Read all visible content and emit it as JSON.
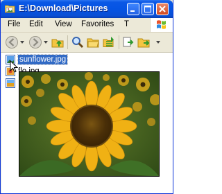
{
  "window": {
    "title": "E:\\Download\\Pictures"
  },
  "menu": {
    "items": [
      "File",
      "Edit",
      "View",
      "Favorites",
      "T"
    ]
  },
  "files": [
    {
      "name": "sunflower.jpg",
      "selected": true
    },
    {
      "name": "flo.jpg",
      "selected": false
    },
    {
      "name": "",
      "selected": false
    }
  ],
  "colors": {
    "titlebar": "#0554e3",
    "selection": "#316ac5",
    "chrome": "#ece9d8"
  },
  "icons": {
    "back": "back-arrow-icon",
    "forward": "forward-arrow-icon",
    "up": "folder-up-icon",
    "search": "search-icon",
    "folders": "folders-icon",
    "move": "move-to-icon",
    "copy": "copy-to-icon"
  }
}
